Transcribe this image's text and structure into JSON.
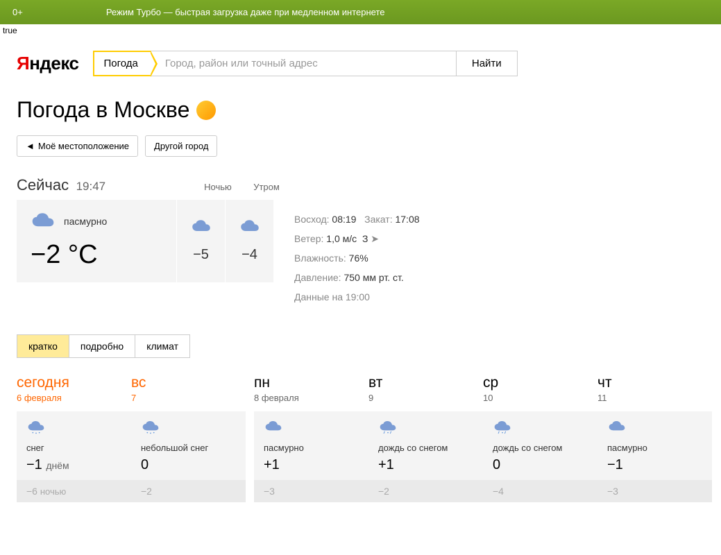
{
  "banner": {
    "age": "0+",
    "text": "Режим Турбо — быстрая загрузка даже при медленном интернете"
  },
  "debug": "true",
  "logo": {
    "y": "Я",
    "rest": "ндекс"
  },
  "search": {
    "tag": "Погода",
    "placeholder": "Город, район или точный адрес",
    "button": "Найти"
  },
  "title": "Погода в Москве",
  "loc": {
    "my": "Моё местоположение",
    "other": "Другой город"
  },
  "now": {
    "label": "Сейчас",
    "time": "19:47",
    "night_label": "Ночью",
    "morning_label": "Утром",
    "condition": "пасмурно",
    "temp": "−2 °C",
    "night_temp": "−5",
    "morning_temp": "−4"
  },
  "details": {
    "sunrise_label": "Восход:",
    "sunrise": "08:19",
    "sunset_label": "Закат:",
    "sunset": "17:08",
    "wind_label": "Ветер:",
    "wind": "1,0 м/с",
    "wind_dir": "З",
    "humidity_label": "Влажность:",
    "humidity": "76%",
    "pressure_label": "Давление:",
    "pressure": "750 мм рт. ст.",
    "data_label": "Данные на",
    "data_time": "19:00"
  },
  "tabs": {
    "brief": "кратко",
    "detailed": "подробно",
    "climate": "климат"
  },
  "forecast": [
    {
      "day": "сегодня",
      "date": "6 февраля",
      "weekend": true,
      "icon": "snow",
      "cond": "снег",
      "day_t": "−1",
      "day_sub": "днём",
      "night_t": "−6",
      "night_sub": "ночью"
    },
    {
      "day": "вс",
      "date": "7",
      "weekend": true,
      "icon": "snow",
      "cond": "небольшой снег",
      "day_t": "0",
      "day_sub": "",
      "night_t": "−2",
      "night_sub": ""
    },
    {
      "day": "пн",
      "date": "8 февраля",
      "weekend": false,
      "icon": "cloud",
      "cond": "пасмурно",
      "day_t": "+1",
      "day_sub": "",
      "night_t": "−3",
      "night_sub": ""
    },
    {
      "day": "вт",
      "date": "9",
      "weekend": false,
      "icon": "sleet",
      "cond": "дождь со снегом",
      "day_t": "+1",
      "day_sub": "",
      "night_t": "−2",
      "night_sub": ""
    },
    {
      "day": "ср",
      "date": "10",
      "weekend": false,
      "icon": "sleet",
      "cond": "дождь со снегом",
      "day_t": "0",
      "day_sub": "",
      "night_t": "−4",
      "night_sub": ""
    },
    {
      "day": "чт",
      "date": "11",
      "weekend": false,
      "icon": "cloud",
      "cond": "пасмурно",
      "day_t": "−1",
      "day_sub": "",
      "night_t": "−3",
      "night_sub": ""
    }
  ]
}
